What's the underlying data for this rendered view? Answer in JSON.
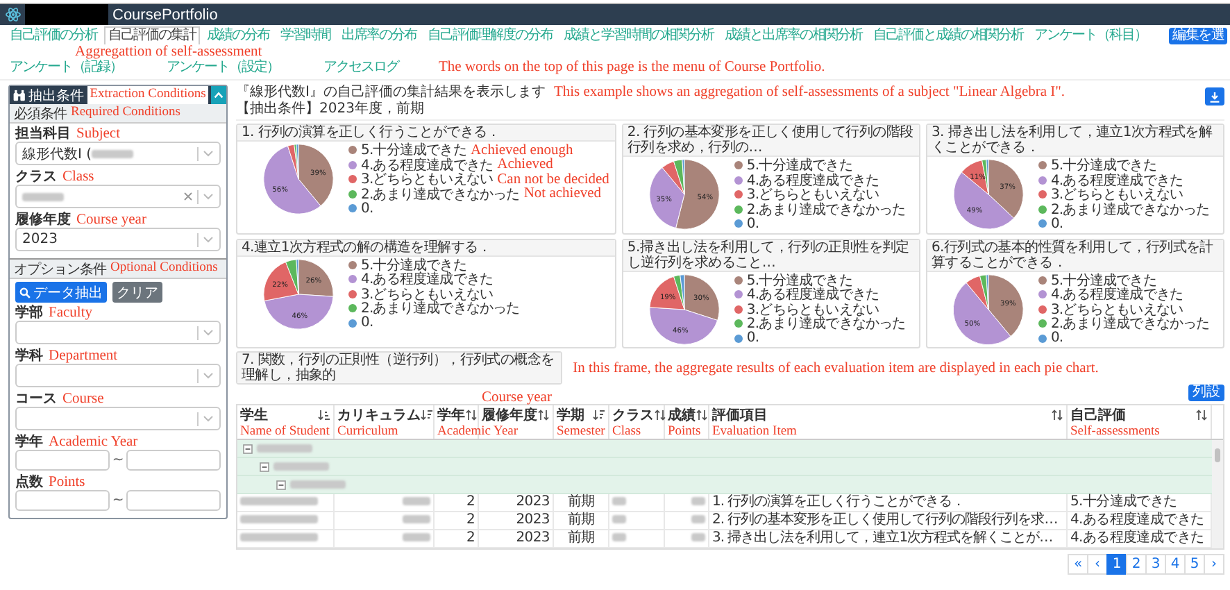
{
  "header": {
    "title": "CoursePortfolio"
  },
  "menu": {
    "rows": [
      {
        "items": [
          {
            "label": "自己評価の分析",
            "selected": false
          },
          {
            "label": "自己評価の集計",
            "selected": true
          },
          {
            "label": "成績の分布",
            "selected": false
          },
          {
            "label": "学習時間",
            "selected": false
          },
          {
            "label": "出席率の分布",
            "selected": false
          },
          {
            "label": "自己評価理解度の分布",
            "selected": false
          },
          {
            "label": "成績と学習時間の相関分析",
            "selected": false
          },
          {
            "label": "成績と出席率の相関分析",
            "selected": false
          },
          {
            "label": "自己評価と成績の相関分析",
            "selected": false
          },
          {
            "label": "アンケート（科目）",
            "selected": false
          }
        ],
        "button": "編集を選"
      },
      {
        "items": [
          {
            "label": "アンケート（記録）",
            "selected": false
          },
          {
            "label": "アンケート（設定）",
            "selected": false
          },
          {
            "label": "アクセスログ",
            "selected": false
          }
        ],
        "note": "The words on the top of this page is the menu of Course Portfolio."
      }
    ],
    "selected_note": "Aggregattion of self-assessment"
  },
  "filter_panel": {
    "title": "抽出条件",
    "note": "Extraction Conditions",
    "sections": [
      {
        "title": "必須条件",
        "note": "Required Conditions",
        "fields": [
          {
            "kind": "select",
            "label": "担当科目",
            "note": "Subject",
            "value": "線形代数Ⅰ (",
            "redacted": true,
            "clearable": false
          },
          {
            "kind": "select",
            "label": "クラス",
            "note": "Class",
            "redacted": true,
            "clearable": true
          },
          {
            "kind": "select",
            "label": "履修年度",
            "note": "Course year",
            "value": "2023",
            "redacted": false,
            "clearable": false
          }
        ]
      },
      {
        "title": "オプション条件",
        "note": "Optional Conditions",
        "buttons": [
          {
            "label": "データ抽出",
            "kind": "primary"
          },
          {
            "label": "クリア",
            "kind": "secondary"
          }
        ],
        "fields": [
          {
            "kind": "select",
            "label": "学部",
            "note": "Faculty",
            "redacted": false,
            "clearable": false
          },
          {
            "kind": "select",
            "label": "学科",
            "note": "Department",
            "redacted": false,
            "clearable": false
          },
          {
            "kind": "select",
            "label": "コース",
            "note": "Course",
            "redacted": false,
            "clearable": false
          },
          {
            "kind": "range",
            "label": "学年",
            "note": "Academic Year",
            "separator": "~"
          },
          {
            "kind": "range",
            "label": "点数",
            "note": "Points",
            "separator": "~"
          }
        ]
      }
    ]
  },
  "summary": {
    "text": "『線形代数Ⅰ』の自己評価の集計結果を表示します",
    "note": "This example shows an aggregation of self-assessments of a subject \"Linear Algebra I\".",
    "condition": "【抽出条件】2023年度，前期"
  },
  "charts": [
    {
      "chart_data": {
        "type": "pie",
        "title": "1. 行列の演算を正しく行うことができる．",
        "categories": [
          "5.十分達成できた",
          "4.ある程度達成できた",
          "3.どちらともいえない",
          "2.あまり達成できなかった",
          "0."
        ],
        "colors": [
          "#a9847a",
          "#b393d3",
          "#e06666",
          "#5cb85c",
          "#5b9bd5"
        ],
        "values": [
          39,
          56,
          3,
          1,
          1
        ],
        "value_labels": [
          "39%",
          "56%",
          null,
          null,
          null
        ]
      },
      "legend_notes": [
        "Achieved enough",
        "Achieved",
        "Can not be decided",
        "Not achieved"
      ]
    },
    {
      "chart_data": {
        "type": "pie",
        "title": "2. 行列の基本変形を正しく使用して行列の階段行列を求め，行列の…",
        "categories": [
          "5.十分達成できた",
          "4.ある程度達成できた",
          "3.どちらともいえない",
          "2.あまり達成できなかった",
          "0."
        ],
        "colors": [
          "#a9847a",
          "#b393d3",
          "#e06666",
          "#5cb85c",
          "#5b9bd5"
        ],
        "values": [
          54,
          35,
          6,
          4,
          1
        ],
        "value_labels": [
          "54%",
          "35%",
          null,
          null,
          null
        ]
      }
    },
    {
      "chart_data": {
        "type": "pie",
        "title": "3. 掃き出し法を利用して，連立1次方程式を解くことができる．",
        "categories": [
          "5.十分達成できた",
          "4.ある程度達成できた",
          "3.どちらともいえない",
          "2.あまり達成できなかった",
          "0."
        ],
        "colors": [
          "#a9847a",
          "#b393d3",
          "#e06666",
          "#5cb85c",
          "#5b9bd5"
        ],
        "values": [
          37,
          49,
          11,
          2,
          1
        ],
        "value_labels": [
          "37%",
          "49%",
          "11%",
          null,
          null
        ]
      }
    },
    {
      "chart_data": {
        "type": "pie",
        "title": "4.連立1次方程式の解の構造を理解する．",
        "categories": [
          "5.十分達成できた",
          "4.ある程度達成できた",
          "3.どちらともいえない",
          "2.あまり達成できなかった",
          "0."
        ],
        "colors": [
          "#a9847a",
          "#b393d3",
          "#e06666",
          "#5cb85c",
          "#5b9bd5"
        ],
        "values": [
          26,
          46,
          22,
          5,
          1
        ],
        "value_labels": [
          "26%",
          "46%",
          "22%",
          null,
          null
        ]
      }
    },
    {
      "chart_data": {
        "type": "pie",
        "title": "5.掃き出し法を利用して，行列の正則性を判定し逆行列を求めること…",
        "categories": [
          "5.十分達成できた",
          "4.ある程度達成できた",
          "3.どちらともいえない",
          "2.あまり達成できなかった",
          "0."
        ],
        "colors": [
          "#a9847a",
          "#b393d3",
          "#e06666",
          "#5cb85c",
          "#5b9bd5"
        ],
        "values": [
          30,
          46,
          19,
          3,
          2
        ],
        "value_labels": [
          "30%",
          "46%",
          "19%",
          null,
          null
        ]
      }
    },
    {
      "chart_data": {
        "type": "pie",
        "title": "6.行列式の基本的性質を利用して，行列式を計算することができる．",
        "categories": [
          "5.十分達成できた",
          "4.ある程度達成できた",
          "3.どちらともいえない",
          "2.あまり達成できなかった",
          "0."
        ],
        "colors": [
          "#a9847a",
          "#b393d3",
          "#e06666",
          "#5cb85c",
          "#5b9bd5"
        ],
        "values": [
          39,
          50,
          7,
          3,
          1
        ],
        "value_labels": [
          "39%",
          "50%",
          null,
          null,
          null
        ]
      }
    }
  ],
  "partial_chart_title": "7. 関数，行列の正則性（逆行列），行列式の概念を理解し，抽象的",
  "charts_note": "In this frame, the aggregate results of each evaluation item are displayed in each pie chart.",
  "table": {
    "columns_button": "列設",
    "columns": [
      {
        "label": "学生",
        "note": "Name of Student",
        "kind": "alpha"
      },
      {
        "label": "カリキュラム",
        "note": "Curriculum",
        "kind": "desc"
      },
      {
        "label": "学年",
        "note": "Academic Year",
        "kind": "plain"
      },
      {
        "label": "履修年度",
        "note_above": "Course year",
        "kind": "plain"
      },
      {
        "label": "学期",
        "note": "Semester",
        "kind": "desc"
      },
      {
        "label": "クラス",
        "note": "Class",
        "kind": "plain"
      },
      {
        "label": "成績",
        "note": "Points",
        "kind": "plain"
      },
      {
        "label": "評価項目",
        "note": "Evaluation Item",
        "kind": "plain"
      },
      {
        "label": "自己評価",
        "note": "Self-assessments",
        "kind": "plain"
      }
    ],
    "groups": [
      {
        "expanded": true,
        "children": [
          {
            "expanded": true,
            "children": [
              {
                "expanded": true
              }
            ]
          }
        ]
      }
    ],
    "rows": [
      {
        "grade": "2",
        "year": "2023",
        "term": "前期",
        "item": "1. 行列の演算を正しく行うことができる．",
        "assessment": "5.十分達成できた"
      },
      {
        "grade": "2",
        "year": "2023",
        "term": "前期",
        "item": "2. 行列の基本変形を正しく使用して行列の階段行列を求…",
        "assessment": "4.ある程度達成できた"
      },
      {
        "grade": "2",
        "year": "2023",
        "term": "前期",
        "item": "3. 掃き出し法を利用して，連立1次方程式を解くことが…",
        "assessment": "4.ある程度達成できた"
      }
    ]
  },
  "pagination": {
    "first": "«",
    "prev": "‹",
    "pages": [
      {
        "label": "1",
        "selected": true
      },
      {
        "label": "2",
        "selected": false
      },
      {
        "label": "3",
        "selected": false
      },
      {
        "label": "4",
        "selected": false
      },
      {
        "label": "5",
        "selected": false
      }
    ],
    "next": "›"
  }
}
